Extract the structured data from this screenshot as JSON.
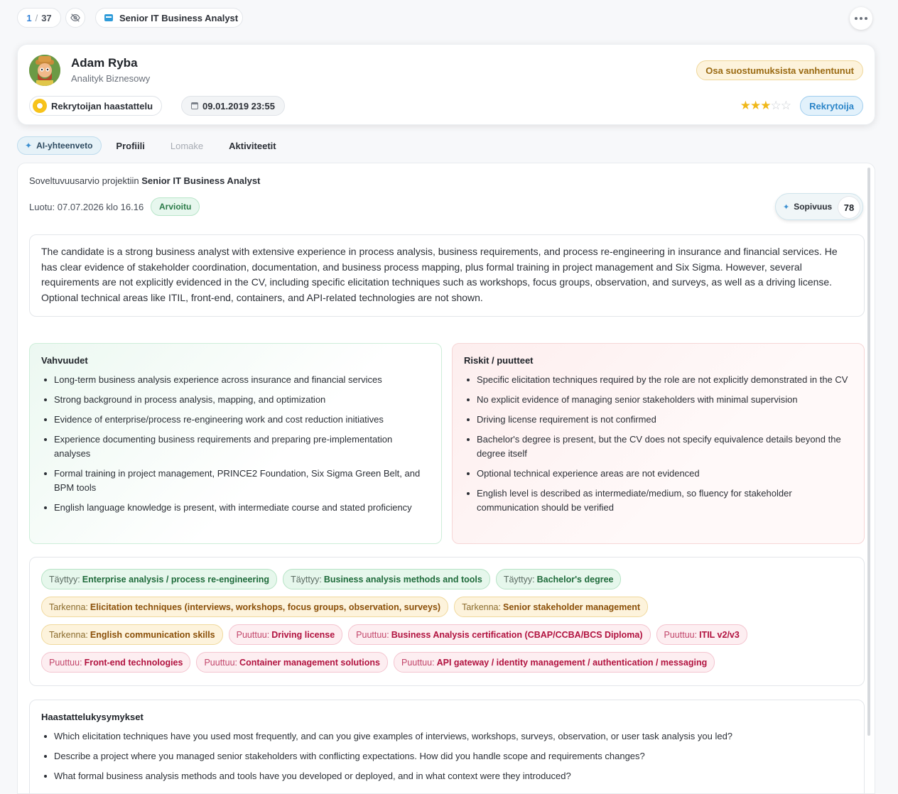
{
  "topbar": {
    "counter_current": "1",
    "counter_separator": "/",
    "counter_total": "37",
    "project": "Senior IT Business Analyst"
  },
  "candidate": {
    "name": "Adam Ryba",
    "role": "Analityk Biznesowy",
    "consent_badge": "Osa suostumuksista vanhentunut",
    "status": "Rekrytoijan haastattelu",
    "date": "09.01.2019 23:55",
    "rating": 3,
    "rating_max": 5,
    "recruit_button": "Rekrytoija"
  },
  "tabs": [
    {
      "label": "AI-yhteenveto",
      "active": true
    },
    {
      "label": "Profiili"
    },
    {
      "label": "Lomake",
      "disabled": true
    },
    {
      "label": "Aktiviteetit"
    }
  ],
  "assessment": {
    "title_prefix": "Soveltuvuusarvio projektiin",
    "title_project": "Senior IT Business Analyst",
    "created": "Luotu: 07.07.2026 klo 16.16",
    "status_badge": "Arvioitu",
    "fit_label": "Sopivuus",
    "fit_score": "78",
    "summary": "The candidate is a strong business analyst with extensive experience in process analysis, business requirements, and process re-engineering in insurance and financial services. He has clear evidence of stakeholder coordination, documentation, and business process mapping, plus formal training in project management and Six Sigma. However, several requirements are not explicitly evidenced in the CV, including specific elicitation techniques such as workshops, focus groups, observation, and surveys, as well as a driving license. Optional technical areas like ITIL, front-end, containers, and API-related technologies are not shown."
  },
  "strengths": {
    "title": "Vahvuudet",
    "items": [
      "Long-term business analysis experience across insurance and financial services",
      "Strong background in process analysis, mapping, and optimization",
      "Evidence of enterprise/process re-engineering work and cost reduction initiatives",
      "Experience documenting business requirements and preparing pre-implementation analyses",
      "Formal training in project management, PRINCE2 Foundation, Six Sigma Green Belt, and BPM tools",
      "English language knowledge is present, with intermediate course and stated proficiency"
    ]
  },
  "risks": {
    "title": "Riskit / puutteet",
    "items": [
      "Specific elicitation techniques required by the role are not explicitly demonstrated in the CV",
      "No explicit evidence of managing senior stakeholders with minimal supervision",
      "Driving license requirement is not confirmed",
      "Bachelor's degree is present, but the CV does not specify equivalence details beyond the degree itself",
      "Optional technical experience areas are not evidenced",
      "English level is described as intermediate/medium, so fluency for stakeholder communication should be verified"
    ]
  },
  "tags": {
    "rows": [
      [
        {
          "kind": "ok",
          "prefix": "Täyttyy:",
          "text": "Enterprise analysis / process re-engineering"
        },
        {
          "kind": "ok",
          "prefix": "Täyttyy:",
          "text": "Business analysis methods and tools"
        },
        {
          "kind": "ok",
          "prefix": "Täyttyy:",
          "text": "Bachelor's degree"
        }
      ],
      [
        {
          "kind": "warn",
          "prefix": "Tarkenna:",
          "text": "Elicitation techniques (interviews, workshops, focus groups, observation, surveys)"
        },
        {
          "kind": "warn",
          "prefix": "Tarkenna:",
          "text": "Senior stakeholder management"
        }
      ],
      [
        {
          "kind": "warn",
          "prefix": "Tarkenna:",
          "text": "English communication skills"
        },
        {
          "kind": "miss",
          "prefix": "Puuttuu:",
          "text": "Driving license"
        },
        {
          "kind": "miss",
          "prefix": "Puuttuu:",
          "text": "Business Analysis certification (CBAP/CCBA/BCS Diploma)"
        },
        {
          "kind": "miss",
          "prefix": "Puuttuu:",
          "text": "ITIL v2/v3"
        }
      ],
      [
        {
          "kind": "miss",
          "prefix": "Puuttuu:",
          "text": "Front-end technologies"
        },
        {
          "kind": "miss",
          "prefix": "Puuttuu:",
          "text": "Container management solutions"
        },
        {
          "kind": "miss",
          "prefix": "Puuttuu:",
          "text": "API gateway / identity management / authentication / messaging"
        }
      ]
    ]
  },
  "questions": {
    "title": "Haastattelukysymykset",
    "items": [
      "Which elicitation techniques have you used most frequently, and can you give examples of interviews, workshops, surveys, observation, or user task analysis you led?",
      "Describe a project where you managed senior stakeholders with conflicting expectations. How did you handle scope and requirements changes?",
      "What formal business analysis methods and tools have you developed or deployed, and in what context were they introduced?"
    ]
  },
  "colors": {
    "accent": "#2f7fd6",
    "ok": "#1f6b3b",
    "warn": "#8a4f08",
    "miss": "#b1123f",
    "star": "#f0b81a"
  }
}
